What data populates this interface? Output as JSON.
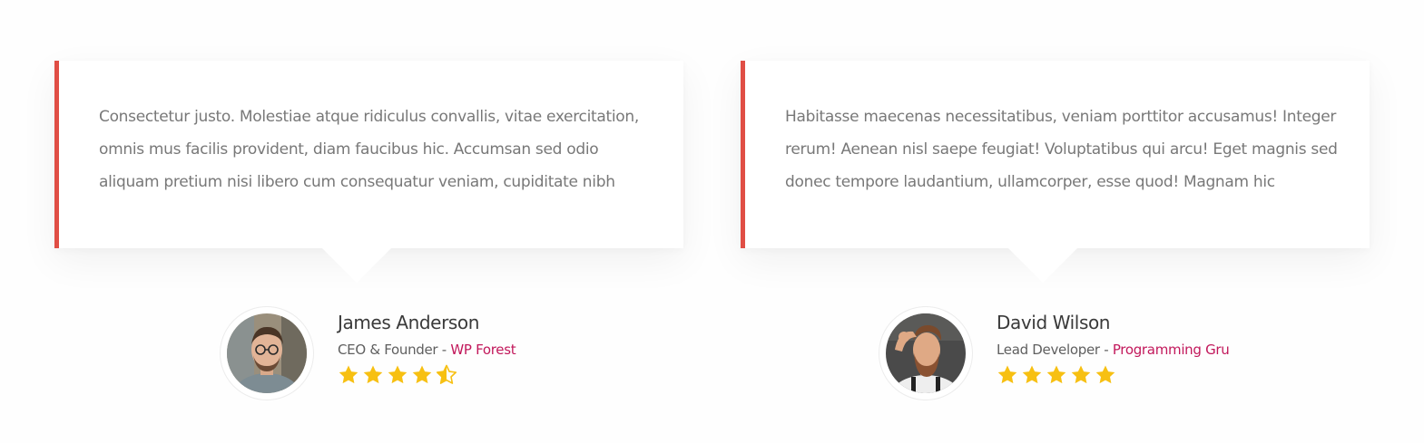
{
  "testimonials": [
    {
      "quote": "Consectetur justo. Molestiae atque ridiculus convallis, vitae exercitation, omnis mus facilis provident, diam faucibus hic. Accumsan sed odio aliquam pretium nisi libero cum consequatur veniam, cupiditate nibh",
      "name": "James Anderson",
      "role": "CEO & Founder",
      "separator": " - ",
      "company": "WP Forest",
      "rating": 4.5,
      "rating_max": 5
    },
    {
      "quote": "Habitasse maecenas necessitatibus, veniam porttitor accusamus! Integer rerum! Aenean nisl saepe feugiat! Voluptatibus qui arcu! Eget magnis sed donec tempore laudantium, ullamcorper, esse quod! Magnam hic",
      "name": "David Wilson",
      "role": "Lead Developer",
      "separator": " - ",
      "company": "Programming Gru",
      "rating": 5,
      "rating_max": 5
    }
  ],
  "colors": {
    "accent_border": "#e04e45",
    "company_link": "#c2185b",
    "star": "#f7c012"
  },
  "icons": {
    "star": "star-icon",
    "half_star": "half-star-icon"
  }
}
